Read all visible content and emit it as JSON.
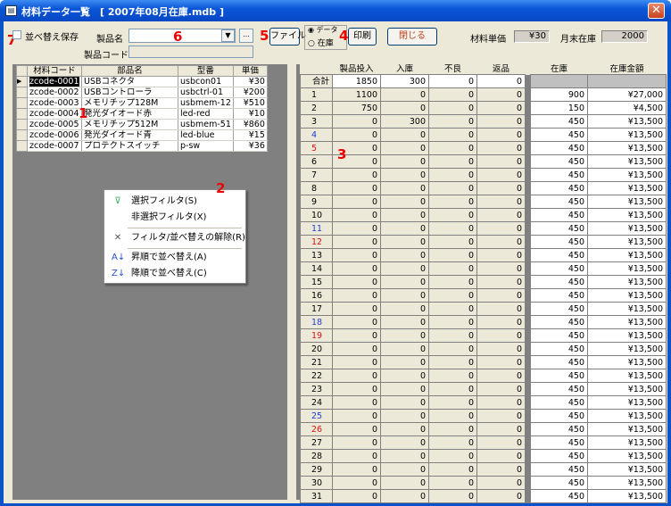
{
  "window": {
    "title": "材料データ一覧　[ 2007年08月在庫.mdb ]",
    "close_label": "✕"
  },
  "toolbar": {
    "sort_save_label": "並べ替え保存",
    "product_name_label": "製品名",
    "product_code_label": "製品コード",
    "browse_label": "...",
    "file_button": "ファイル",
    "radio_data": "データ",
    "radio_stock": "在庫",
    "print_button": "印刷",
    "close_button": "閉じる",
    "material_price_label": "材料単価",
    "material_price_value": "¥30",
    "month_end_stock_label": "月末在庫",
    "month_end_stock_value": "2000"
  },
  "annotations": [
    "1",
    "2",
    "3",
    "4",
    "5",
    "6",
    "7"
  ],
  "parts_table": {
    "headers": [
      "材料コード",
      "部品名",
      "型番",
      "単価"
    ],
    "rows": [
      [
        "zcode-0001",
        "USBコネクタ",
        "usbcon01",
        "¥30"
      ],
      [
        "zcode-0002",
        "USBコントローラ",
        "usbctrl-01",
        "¥200"
      ],
      [
        "zcode-0003",
        "メモリチップ128M",
        "usbmem-12",
        "¥510"
      ],
      [
        "zcode-0004",
        "発光ダイオード赤",
        "led-red",
        "¥10"
      ],
      [
        "zcode-0005",
        "メモリチップ512M",
        "usbmem-51",
        "¥860"
      ],
      [
        "zcode-0006",
        "発光ダイオード青",
        "led-blue",
        "¥15"
      ],
      [
        "zcode-0007",
        "プロテクトスイッチ",
        "p-sw",
        "¥36"
      ]
    ]
  },
  "context_menu": {
    "items": [
      {
        "label": "選択フィルタ(S)",
        "icon": "filter-select-icon"
      },
      {
        "label": "非選択フィルタ(X)",
        "icon": ""
      },
      {
        "label": "フィルタ/並べ替えの解除(R)",
        "icon": "filter-remove-icon"
      },
      {
        "label": "昇順で並べ替え(A)",
        "icon": "sort-ascending-icon"
      },
      {
        "label": "降順で並べ替え(C)",
        "icon": "sort-descending-icon"
      }
    ]
  },
  "daily_table": {
    "headers": [
      "製品投入",
      "入庫",
      "不良",
      "返品",
      "在庫",
      "在庫金額"
    ],
    "total_label": "合計",
    "total": [
      "1850",
      "300",
      "0",
      "0",
      "",
      ""
    ],
    "rows": [
      {
        "day": "1",
        "v": [
          "1100",
          "0",
          "0",
          "0",
          "900",
          "¥27,000"
        ]
      },
      {
        "day": "2",
        "v": [
          "750",
          "0",
          "0",
          "0",
          "150",
          "¥4,500"
        ]
      },
      {
        "day": "3",
        "v": [
          "0",
          "300",
          "0",
          "0",
          "450",
          "¥13,500"
        ]
      },
      {
        "day": "4",
        "v": [
          "0",
          "0",
          "0",
          "0",
          "450",
          "¥13,500"
        ]
      },
      {
        "day": "5",
        "v": [
          "0",
          "0",
          "0",
          "0",
          "450",
          "¥13,500"
        ]
      },
      {
        "day": "6",
        "v": [
          "0",
          "0",
          "0",
          "0",
          "450",
          "¥13,500"
        ]
      },
      {
        "day": "7",
        "v": [
          "0",
          "0",
          "0",
          "0",
          "450",
          "¥13,500"
        ]
      },
      {
        "day": "8",
        "v": [
          "0",
          "0",
          "0",
          "0",
          "450",
          "¥13,500"
        ]
      },
      {
        "day": "9",
        "v": [
          "0",
          "0",
          "0",
          "0",
          "450",
          "¥13,500"
        ]
      },
      {
        "day": "10",
        "v": [
          "0",
          "0",
          "0",
          "0",
          "450",
          "¥13,500"
        ]
      },
      {
        "day": "11",
        "v": [
          "0",
          "0",
          "0",
          "0",
          "450",
          "¥13,500"
        ]
      },
      {
        "day": "12",
        "v": [
          "0",
          "0",
          "0",
          "0",
          "450",
          "¥13,500"
        ]
      },
      {
        "day": "13",
        "v": [
          "0",
          "0",
          "0",
          "0",
          "450",
          "¥13,500"
        ]
      },
      {
        "day": "14",
        "v": [
          "0",
          "0",
          "0",
          "0",
          "450",
          "¥13,500"
        ]
      },
      {
        "day": "15",
        "v": [
          "0",
          "0",
          "0",
          "0",
          "450",
          "¥13,500"
        ]
      },
      {
        "day": "16",
        "v": [
          "0",
          "0",
          "0",
          "0",
          "450",
          "¥13,500"
        ]
      },
      {
        "day": "17",
        "v": [
          "0",
          "0",
          "0",
          "0",
          "450",
          "¥13,500"
        ]
      },
      {
        "day": "18",
        "v": [
          "0",
          "0",
          "0",
          "0",
          "450",
          "¥13,500"
        ]
      },
      {
        "day": "19",
        "v": [
          "0",
          "0",
          "0",
          "0",
          "450",
          "¥13,500"
        ]
      },
      {
        "day": "20",
        "v": [
          "0",
          "0",
          "0",
          "0",
          "450",
          "¥13,500"
        ]
      },
      {
        "day": "21",
        "v": [
          "0",
          "0",
          "0",
          "0",
          "450",
          "¥13,500"
        ]
      },
      {
        "day": "22",
        "v": [
          "0",
          "0",
          "0",
          "0",
          "450",
          "¥13,500"
        ]
      },
      {
        "day": "23",
        "v": [
          "0",
          "0",
          "0",
          "0",
          "450",
          "¥13,500"
        ]
      },
      {
        "day": "24",
        "v": [
          "0",
          "0",
          "0",
          "0",
          "450",
          "¥13,500"
        ]
      },
      {
        "day": "25",
        "v": [
          "0",
          "0",
          "0",
          "0",
          "450",
          "¥13,500"
        ]
      },
      {
        "day": "26",
        "v": [
          "0",
          "0",
          "0",
          "0",
          "450",
          "¥13,500"
        ]
      },
      {
        "day": "27",
        "v": [
          "0",
          "0",
          "0",
          "0",
          "450",
          "¥13,500"
        ]
      },
      {
        "day": "28",
        "v": [
          "0",
          "0",
          "0",
          "0",
          "450",
          "¥13,500"
        ]
      },
      {
        "day": "29",
        "v": [
          "0",
          "0",
          "0",
          "0",
          "450",
          "¥13,500"
        ]
      },
      {
        "day": "30",
        "v": [
          "0",
          "0",
          "0",
          "0",
          "450",
          "¥13,500"
        ]
      },
      {
        "day": "31",
        "v": [
          "0",
          "0",
          "0",
          "0",
          "450",
          "¥13,500"
        ]
      }
    ],
    "saturday_days": [
      "4",
      "11",
      "18",
      "25"
    ],
    "sunday_days": [
      "5",
      "12",
      "19",
      "26"
    ]
  },
  "colors": {
    "saturday": "#1d3fd8",
    "sunday": "#e01010",
    "annotation": "#e00000"
  }
}
